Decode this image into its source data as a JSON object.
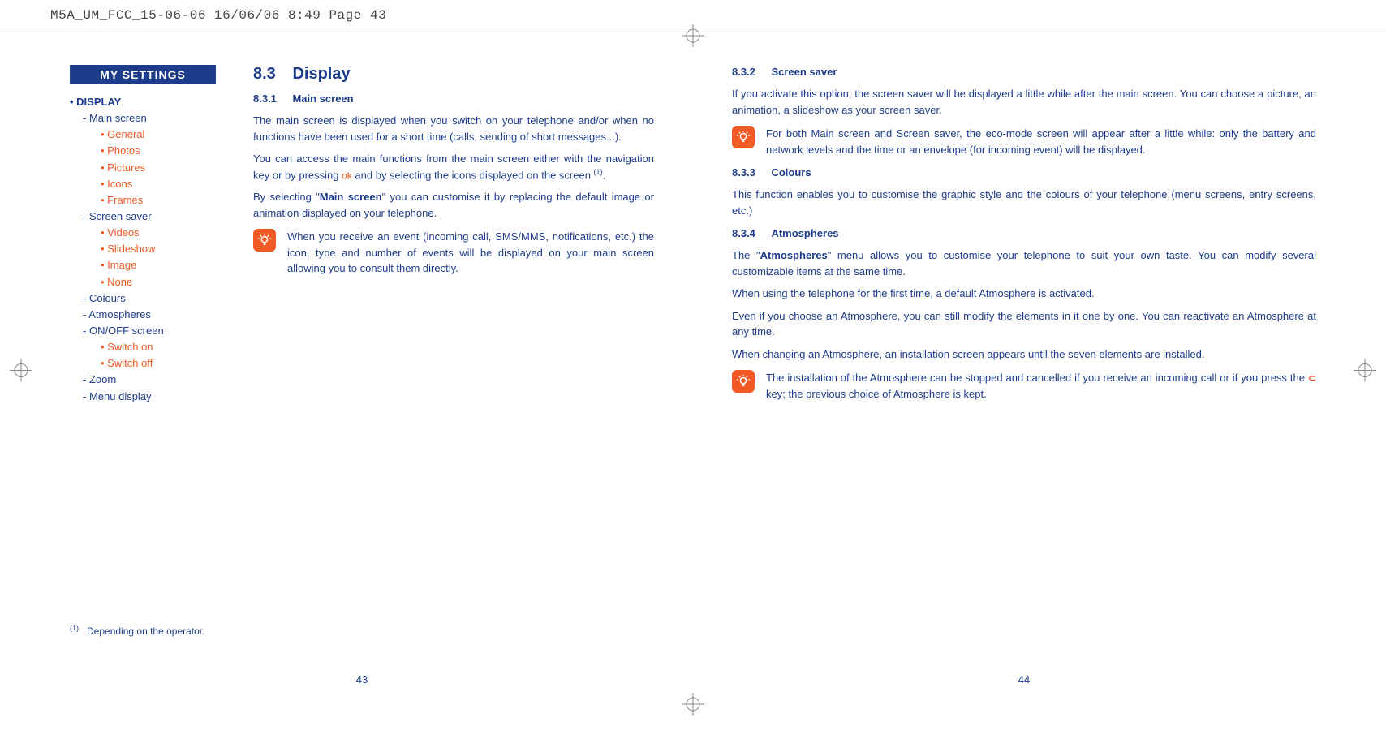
{
  "header": "M5A_UM_FCC_15-06-06  16/06/06  8:49  Page 43",
  "sidebar": {
    "tab": "MY SETTINGS",
    "top": "• DISPLAY",
    "items": [
      {
        "label": "Main screen",
        "type": "dash",
        "children": [
          {
            "label": "General",
            "type": "bullet"
          },
          {
            "label": "Photos",
            "type": "bullet"
          },
          {
            "label": "Pictures",
            "type": "bullet"
          },
          {
            "label": "Icons",
            "type": "bullet"
          },
          {
            "label": "Frames",
            "type": "bullet"
          }
        ]
      },
      {
        "label": "Screen saver",
        "type": "dash",
        "children": [
          {
            "label": "Videos",
            "type": "bullet"
          },
          {
            "label": "Slideshow",
            "type": "bullet"
          },
          {
            "label": "Image",
            "type": "bullet"
          },
          {
            "label": "None",
            "type": "bullet"
          }
        ]
      },
      {
        "label": "Colours",
        "type": "dash"
      },
      {
        "label": "Atmospheres",
        "type": "dash"
      },
      {
        "label": "ON/OFF screen",
        "type": "dash",
        "children": [
          {
            "label": "Switch on",
            "type": "bullet"
          },
          {
            "label": "Switch off",
            "type": "bullet"
          }
        ]
      },
      {
        "label": "Zoom",
        "type": "dash"
      },
      {
        "label": "Menu display",
        "type": "dash"
      }
    ]
  },
  "left": {
    "h_num": "8.3",
    "h_title": "Display",
    "s1_num": "8.3.1",
    "s1_title": "Main screen",
    "p1": "The main screen is displayed when you switch on your telephone and/or when no functions have been used for a short time (calls, sending of short messages...).",
    "p2a": "You can access the main functions from the main screen either with the navigation key or by pressing ",
    "p2_ok": "ok",
    "p2b": " and by selecting the icons displayed on the screen ",
    "p2_sup": "(1)",
    "p2c": ".",
    "p3a": "By selecting \"",
    "p3_bold": "Main screen",
    "p3b": "\" you can customise it by replacing the default image or animation displayed on your telephone.",
    "note1": "When you receive an event (incoming call, SMS/MMS, notifications, etc.) the icon, type and number of events will be displayed on your main screen allowing you to consult them directly.",
    "footnote_sup": "(1)",
    "footnote": "Depending on the operator.",
    "page_num": "43"
  },
  "right": {
    "s2_num": "8.3.2",
    "s2_title": "Screen saver",
    "p4": "If you activate this option, the screen saver will be displayed a little while after the main screen. You can choose a picture, an animation, a slideshow as your screen saver.",
    "note2": "For both Main screen and Screen saver, the eco-mode screen will appear after a little while: only the battery and network levels and the time or an envelope (for incoming event) will be displayed.",
    "s3_num": "8.3.3",
    "s3_title": "Colours",
    "p5": "This function enables you to customise the graphic style and the colours of your telephone (menu screens, entry screens, etc.)",
    "s4_num": "8.3.4",
    "s4_title": "Atmospheres",
    "p6a": "The \"",
    "p6_bold": "Atmospheres",
    "p6b": "\" menu allows you to customise your telephone to suit your own taste. You can modify several customizable items at the same time.",
    "p7": "When using the telephone for the first time, a default Atmosphere is activated.",
    "p8": "Even if you choose an Atmosphere, you can still modify the elements in it one by one. You can reactivate an Atmosphere at any time.",
    "p9": "When changing an Atmosphere, an installation screen appears until the seven elements are installed.",
    "note3a": "The installation of the Atmosphere can be stopped and cancelled if you receive an incoming call or if you press the ",
    "note3_key": "C",
    "note3b": " key; the previous choice of Atmosphere is kept.",
    "page_num": "44"
  }
}
